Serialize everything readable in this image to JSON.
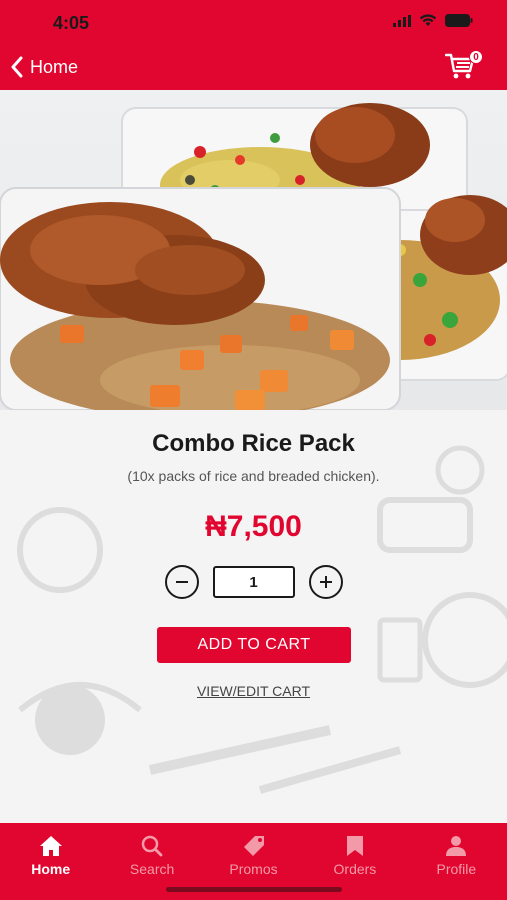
{
  "status_bar": {
    "time": "4:05"
  },
  "nav": {
    "back_label": "Home",
    "cart_count": "0"
  },
  "product": {
    "title": "Combo Rice Pack",
    "description": "(10x packs of rice and breaded chicken).",
    "price": "₦7,500",
    "quantity": "1",
    "add_to_cart_label": "ADD TO CART",
    "view_cart_label": "VIEW/EDIT CART"
  },
  "tabs": [
    {
      "label": "Home",
      "icon": "home-icon",
      "active": true
    },
    {
      "label": "Search",
      "icon": "search-icon",
      "active": false
    },
    {
      "label": "Promos",
      "icon": "tag-icon",
      "active": false
    },
    {
      "label": "Orders",
      "icon": "bookmark-icon",
      "active": false
    },
    {
      "label": "Profile",
      "icon": "person-icon",
      "active": false
    }
  ],
  "colors": {
    "brand_red": "#e1062f",
    "inactive_tab": "#f39aa9"
  }
}
